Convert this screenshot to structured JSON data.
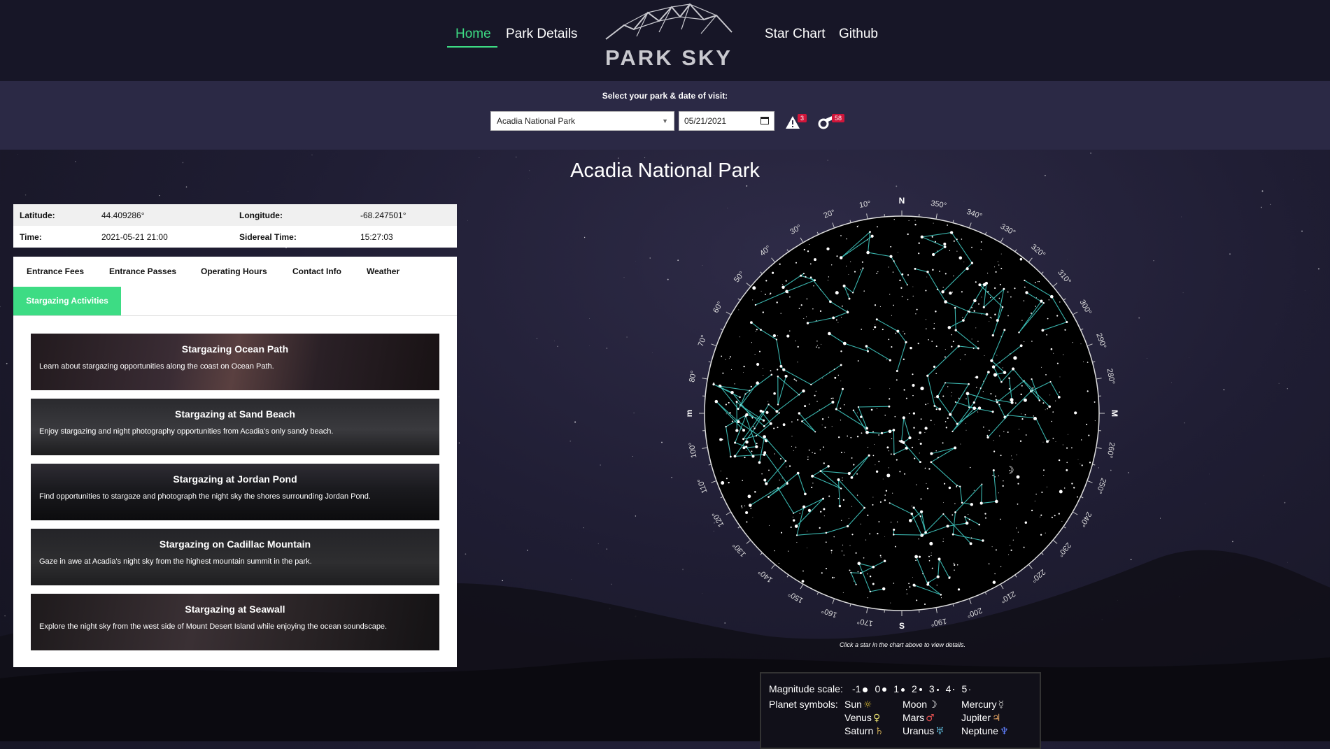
{
  "nav": {
    "home": "Home",
    "park_details": "Park Details",
    "logo": "PARK SKY",
    "star_chart": "Star Chart",
    "github": "Github"
  },
  "selector": {
    "label": "Select your park & date of visit:",
    "park": "Acadia National Park",
    "date": "05/21/2021",
    "alerts_count": "3",
    "events_count": "58"
  },
  "park_title": "Acadia National Park",
  "info": {
    "latitude_label": "Latitude:",
    "latitude": "44.409286°",
    "longitude_label": "Longitude:",
    "longitude": "-68.247501°",
    "time_label": "Time:",
    "time": "2021-05-21 21:00",
    "sidereal_label": "Sidereal Time:",
    "sidereal": "15:27:03"
  },
  "tabs": [
    "Entrance Fees",
    "Entrance Passes",
    "Operating Hours",
    "Contact Info",
    "Weather",
    "Stargazing Activities"
  ],
  "activities": [
    {
      "title": "Stargazing Ocean Path",
      "desc": "Learn about stargazing opportunities along the coast on Ocean Path."
    },
    {
      "title": "Stargazing at Sand Beach",
      "desc": "Enjoy stargazing and night photography opportunities from Acadia's only sandy beach."
    },
    {
      "title": "Stargazing at Jordan Pond",
      "desc": "Find opportunities to stargaze and photograph the night sky the shores surrounding Jordan Pond."
    },
    {
      "title": "Stargazing on Cadillac Mountain",
      "desc": "Gaze in awe at Acadia's night sky from the highest mountain summit in the park."
    },
    {
      "title": "Stargazing at Seawall",
      "desc": "Explore the night sky from the west side of Mount Desert Island while enjoying the ocean soundscape."
    }
  ],
  "chart": {
    "compass": {
      "N": "N",
      "S": "S",
      "E": "m",
      "W": "M"
    },
    "degree_labels": [
      "10°",
      "20°",
      "30°",
      "40°",
      "50°",
      "60°",
      "70°",
      "80°",
      "100°",
      "110°",
      "120°",
      "130°",
      "140°",
      "150°",
      "160°",
      "170°",
      "190°",
      "200°",
      "210°",
      "220°",
      "230°",
      "240°",
      "250°",
      "260°",
      "280°",
      "290°",
      "300°",
      "310°",
      "320°",
      "330°",
      "340°",
      "350°"
    ],
    "caption": "Click a star in the chart above to view details.",
    "line_color": "#3fc8c0"
  },
  "legend": {
    "magnitude_label": "Magnitude scale:",
    "magnitudes": [
      "-1",
      "0",
      "1",
      "2",
      "3",
      "4",
      "5"
    ],
    "planet_label": "Planet symbols:",
    "planets": [
      {
        "name": "Sun",
        "symbol": "☼",
        "color": "#e0c030"
      },
      {
        "name": "Moon",
        "symbol": "☽",
        "color": "#ffffff"
      },
      {
        "name": "Mercury",
        "symbol": "☿",
        "color": "#aaaaaa"
      },
      {
        "name": "Venus",
        "symbol": "♀",
        "color": "#e8e070"
      },
      {
        "name": "Mars",
        "symbol": "♂",
        "color": "#e05050"
      },
      {
        "name": "Jupiter",
        "symbol": "♃",
        "color": "#e0a060"
      },
      {
        "name": "Saturn",
        "symbol": "♄",
        "color": "#c0a050"
      },
      {
        "name": "Uranus",
        "symbol": "♅",
        "color": "#60c0e0"
      },
      {
        "name": "Neptune",
        "symbol": "♆",
        "color": "#6080ff"
      }
    ]
  }
}
